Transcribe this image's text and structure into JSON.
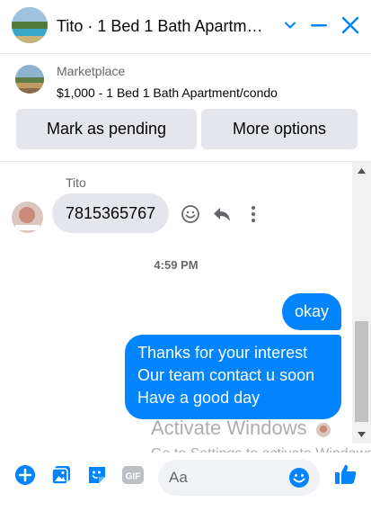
{
  "header": {
    "title": "Tito · 1 Bed 1 Bath Apartm…",
    "colors": {
      "accent": "#0084ff"
    }
  },
  "marketplace": {
    "label": "Marketplace",
    "listing": "$1,000 - 1 Bed 1 Bath Apartment/condo",
    "mark_pending_label": "Mark as pending",
    "more_options_label": "More options"
  },
  "thread": {
    "sender_name": "Tito",
    "incoming_message": "7815365767",
    "timestamp": "4:59 PM",
    "outgoing_messages": [
      {
        "lines": [
          "okay"
        ]
      },
      {
        "lines": [
          "Thanks for your interest",
          "Our team contact u soon",
          "Have a good day"
        ]
      }
    ]
  },
  "watermark": {
    "line1": "Activate Windows",
    "line2": "Go to Settings to activate Windows."
  },
  "composer": {
    "placeholder": "Aa",
    "icons": [
      "plus-circle-icon",
      "photo-icon",
      "sticker-icon",
      "gif-icon",
      "emoji-icon",
      "thumbs-up-icon"
    ]
  }
}
